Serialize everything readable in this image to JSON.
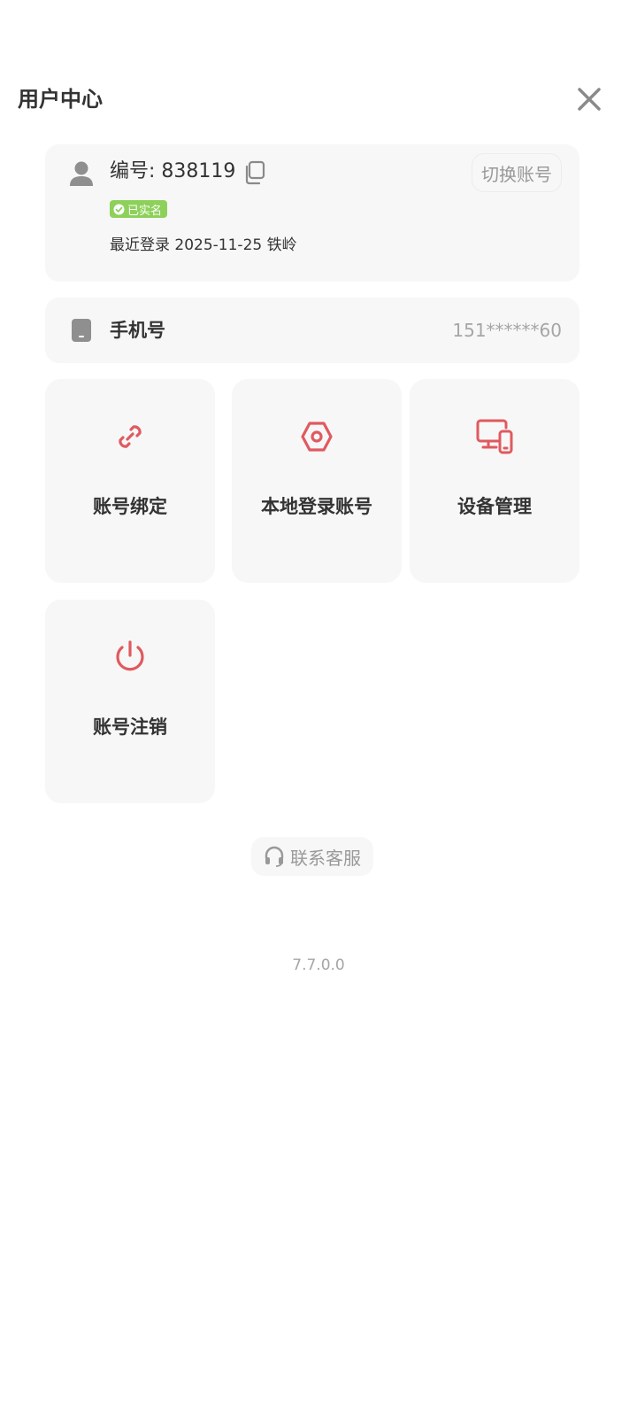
{
  "header": {
    "title": "用户中心",
    "close_icon": "close-icon"
  },
  "account": {
    "id_prefix": "编号: ",
    "id_value": "838119",
    "verified_label": "已实名",
    "last_login": "最近登录 2025-11-25 铁岭",
    "switch_label": "切换账号",
    "icons": [
      "user-icon",
      "copy-icon",
      "check-circle-icon"
    ]
  },
  "phone": {
    "label": "手机号",
    "value": "151******60",
    "icon": "phone-icon"
  },
  "tiles": [
    {
      "label": "账号绑定",
      "icon": "link-icon"
    },
    {
      "label": "本地登录账号",
      "icon": "hex-nut-icon"
    },
    {
      "label": "设备管理",
      "icon": "devices-icon"
    },
    {
      "label": "账号注销",
      "icon": "power-icon"
    }
  ],
  "support": {
    "label": "联系客服",
    "icon": "headset-icon"
  },
  "version": "7.7.0.0",
  "colors": {
    "accent": "#e05a5f",
    "card_bg": "#f7f7f7",
    "verified_badge": "#8dd15a",
    "muted_text": "#999999"
  }
}
